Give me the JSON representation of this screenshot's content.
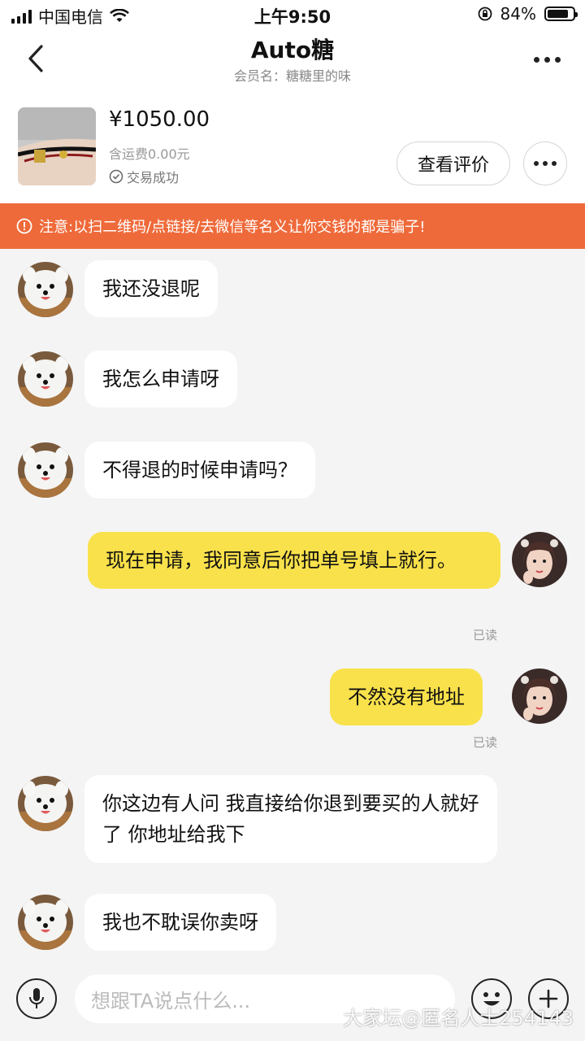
{
  "status": {
    "carrier": "中国电信",
    "time": "上午9:50",
    "battery": "84%",
    "battery_level": 0.84
  },
  "nav": {
    "title": "Auto糖",
    "subtitle": "会员名：糖糖里的味"
  },
  "product": {
    "price": "¥1050.00",
    "shipping": "含运费0.00元",
    "status": "交易成功",
    "review_button": "查看评价"
  },
  "warning": "注意:以扫二维码/点链接/去微信等名义让你交钱的都是骗子!",
  "messages": [
    {
      "side": "in",
      "text": "我还没退呢"
    },
    {
      "side": "in",
      "text": "我怎么申请呀"
    },
    {
      "side": "in",
      "text": "不得退的时候申请吗？"
    },
    {
      "side": "out",
      "text": "现在申请，我同意后你把单号填上就行。",
      "read": "已读"
    },
    {
      "side": "out",
      "text": "不然没有地址",
      "read": "已读"
    },
    {
      "side": "in",
      "text": "你这边有人问 我直接给你退到要买的人就好了 你地址给我下"
    },
    {
      "side": "in",
      "text": "我也不耽误你卖呀"
    }
  ],
  "input": {
    "placeholder": "想跟TA说点什么..."
  },
  "watermark": "大家坛@匿名人士254143",
  "colors": {
    "warning": "#ef6a3a",
    "outgoing_bubble": "#f9e14b",
    "background": "#f4f4f4"
  }
}
